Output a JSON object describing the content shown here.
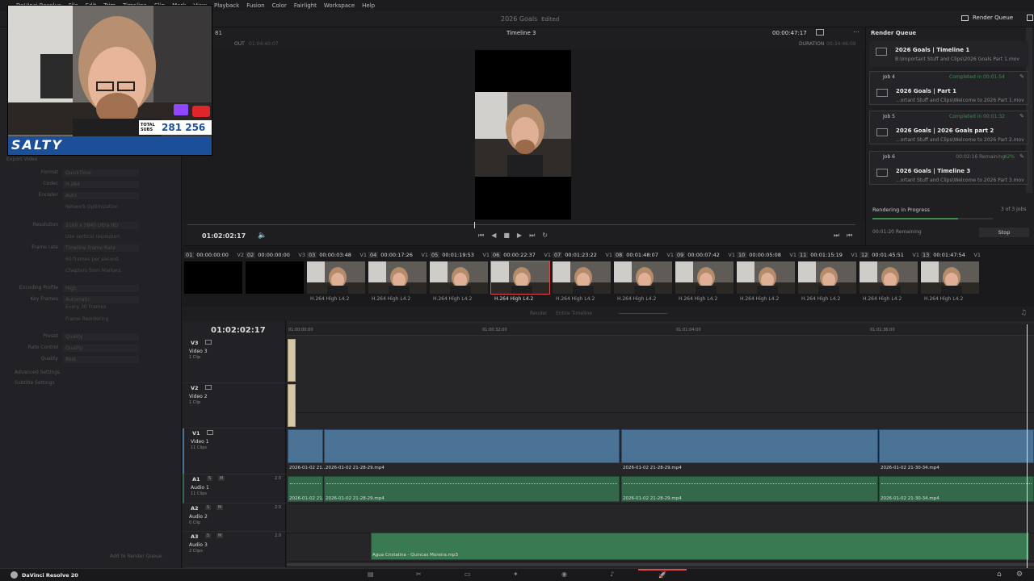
{
  "menu": [
    "DaVinci Resolve",
    "File",
    "Edit",
    "Trim",
    "Timeline",
    "Clip",
    "Mark",
    "View",
    "Playback",
    "Fusion",
    "Color",
    "Fairlight",
    "Workspace",
    "Help"
  ],
  "project": {
    "title": "2026 Goals",
    "status": "Edited"
  },
  "render_queue_button": "Render Queue",
  "webcam": {
    "subs_label": "TOTAL SUBS",
    "subs_count": "281 256",
    "brand": "SALTY"
  },
  "left_panel": {
    "export_video": "Export Video",
    "rows": [
      {
        "label": "Format",
        "value": "QuickTime"
      },
      {
        "label": "Codec",
        "value": "H.264"
      },
      {
        "label": "Encoder",
        "value": "Auto"
      },
      {
        "label": "",
        "value": "Network Optimization"
      },
      {
        "label": "Resolution",
        "value": "2160 x 3840 Ultra HD"
      },
      {
        "label": "",
        "value": "Use vertical resolution"
      },
      {
        "label": "Frame rate",
        "value": "Timeline Frame Rate"
      },
      {
        "label": "",
        "value": "60 frames per second"
      },
      {
        "label": "",
        "value": "Chapters from Markers"
      },
      {
        "label": "Encoding Profile",
        "value": "High"
      },
      {
        "label": "Key Frames",
        "value": "Automatic"
      },
      {
        "label": "",
        "value": "Every 30 Frames"
      },
      {
        "label": "",
        "value": "Frame Reordering"
      },
      {
        "label": "Preset",
        "value": "Quality"
      },
      {
        "label": "Rate Control",
        "value": "Quality"
      },
      {
        "label": "Quality",
        "value": "Best"
      }
    ],
    "advanced": "Advanced Settings",
    "subtitle": "Subtitle Settings",
    "add_button": "Add to Render Queue"
  },
  "viewer": {
    "in_label": "81",
    "out_label": "OUT",
    "out_tc": "01:04:40:07",
    "timeline_name": "Timeline 3",
    "tc": "00:00:47:17",
    "duration_label": "DURATION",
    "duration": "00:34:46:09",
    "playhead_tc": "01:02:02:17"
  },
  "clips": [
    {
      "num": "01",
      "tc": "00:00:00:00",
      "trk": "V2",
      "cap": ""
    },
    {
      "num": "02",
      "tc": "00:00:00:00",
      "trk": "V3",
      "cap": ""
    },
    {
      "num": "03",
      "tc": "00:00:03:48",
      "trk": "V1",
      "cap": "H.264 High L4.2"
    },
    {
      "num": "04",
      "tc": "00:00:17:26",
      "trk": "V1",
      "cap": "H.264 High L4.2"
    },
    {
      "num": "05",
      "tc": "00:01:19:53",
      "trk": "V1",
      "cap": "H.264 High L4.2"
    },
    {
      "num": "06",
      "tc": "00:00:22:37",
      "trk": "V1",
      "cap": "H.264 High L4.2"
    },
    {
      "num": "07",
      "tc": "00:01:23:22",
      "trk": "V1",
      "cap": "H.264 High L4.2"
    },
    {
      "num": "08",
      "tc": "00:01:48:07",
      "trk": "V1",
      "cap": "H.264 High L4.2"
    },
    {
      "num": "09",
      "tc": "00:00:07:42",
      "trk": "V1",
      "cap": "H.264 High L4.2"
    },
    {
      "num": "10",
      "tc": "00:00:05:08",
      "trk": "V1",
      "cap": "H.264 High L4.2"
    },
    {
      "num": "11",
      "tc": "00:01:15:19",
      "trk": "V1",
      "cap": "H.264 High L4.2"
    },
    {
      "num": "12",
      "tc": "00:01:45:51",
      "trk": "V1",
      "cap": "H.264 High L4.2"
    },
    {
      "num": "13",
      "tc": "00:01:47:54",
      "trk": "V1",
      "cap": "H.264 High L4.2"
    }
  ],
  "render_queue": {
    "title": "Render Queue",
    "jobs": [
      {
        "header": "",
        "status": "",
        "title": "2026 Goals | Timeline 1",
        "path": "B:\\Important Stuff and Clips\\2026 Goals Part 1.mov"
      },
      {
        "header": "Job 4",
        "status": "Completed in 00:01:54",
        "title": "2026 Goals | Part 1",
        "path": "...ortant Stuff and Clips\\Welcome to 2026 Part 1.mov"
      },
      {
        "header": "Job 5",
        "status": "Completed in 00:01:32",
        "title": "2026 Goals | 2026 Goals part 2",
        "path": "...ortant Stuff and Clips\\Welcome to 2026 Part 2.mov"
      },
      {
        "header": "Job 6",
        "status": "00:02:16 Remaining",
        "pct": "42%",
        "title": "2026 Goals | Timeline 3",
        "path": "...ortant Stuff and Clips\\Welcome to 2026 Part 3.mov"
      }
    ],
    "progress_label": "Rendering in Progress",
    "progress_count": "3 of 3 Jobs",
    "progress_fraction": 0.71,
    "remaining": "00:01:20 Remaining",
    "stop": "Stop"
  },
  "timeline": {
    "render_label": "Render",
    "render_value": "Entire Timeline",
    "tc": "01:02:02:17",
    "ruler": [
      "01:00:00:00",
      "01:00:32:00",
      "01:01:04:00",
      "01:01:36:00"
    ],
    "tracks": [
      {
        "id": "V3",
        "name": "Video 3",
        "count": "1 Clip"
      },
      {
        "id": "V2",
        "name": "Video 2",
        "count": "1 Clip"
      },
      {
        "id": "V1",
        "name": "Video 1",
        "count": "11 Clips"
      },
      {
        "id": "A1",
        "name": "Audio 1",
        "count": "11 Clips",
        "level": "2.0"
      },
      {
        "id": "A2",
        "name": "Audio 2",
        "count": "0 Clip",
        "level": "2.0"
      },
      {
        "id": "A3",
        "name": "Audio 3",
        "count": "2 Clips",
        "level": "2.0"
      }
    ],
    "clip_labels": {
      "v1": [
        "2026-01-02 21...",
        "2026-01-02 21-28-29.mp4",
        "2026-01-02 21-28-29.mp4",
        "2026-01-02 21-30-34.mp4"
      ],
      "a1": [
        "2026-01-02 21...",
        "2026-01-02 21-28-29.mp4",
        "2026-01-02 21-28-29.mp4",
        "2026-01-02 21-30-34.mp4"
      ],
      "a3": "Agua Cristalina - Quincas Moreira.mp3"
    }
  },
  "bottom": {
    "app": "DaVinci Resolve 20"
  },
  "colors": {
    "accent": "#e0464e",
    "video": "#4a7396",
    "audio": "#33694a",
    "green": "#3e8d4a"
  }
}
